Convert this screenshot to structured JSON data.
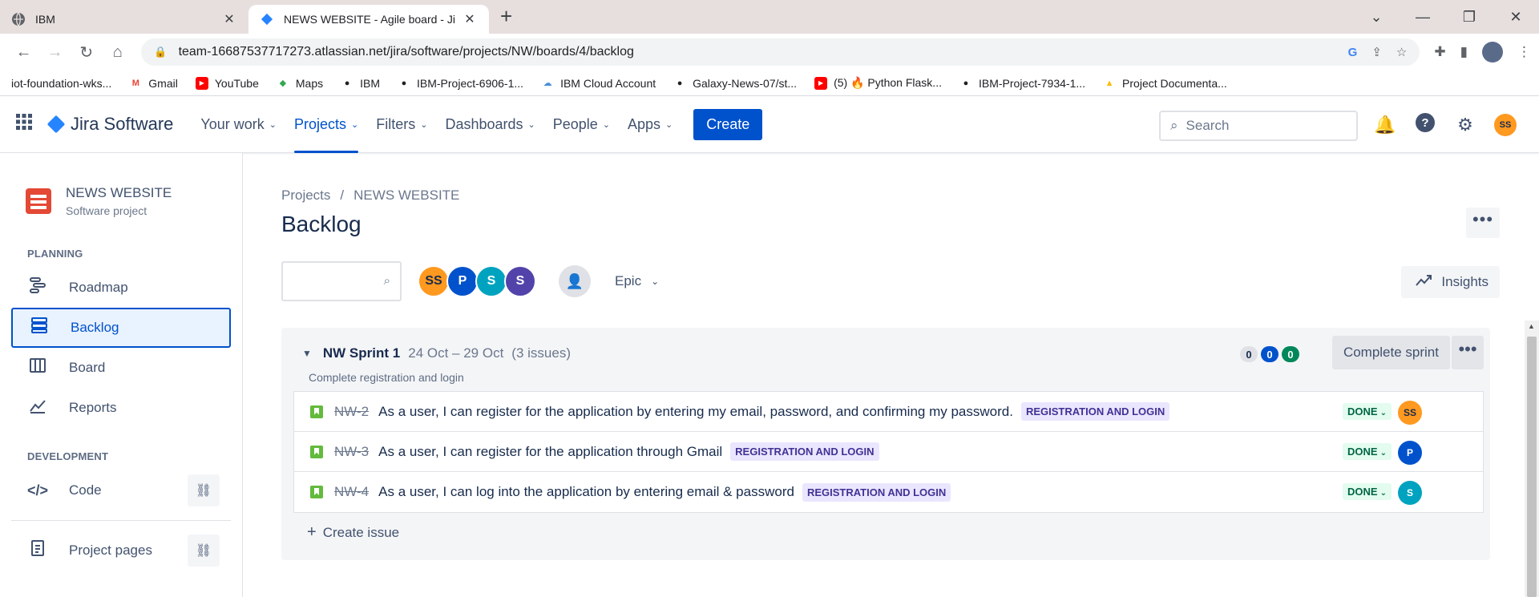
{
  "browser": {
    "tabs": [
      {
        "title": "IBM",
        "active": false
      },
      {
        "title": "NEWS WEBSITE - Agile board - Ji",
        "active": true
      }
    ],
    "url": "team-16687537717273.atlassian.net/jira/software/projects/NW/boards/4/backlog",
    "bookmarks": [
      "iot-foundation-wks...",
      "Gmail",
      "YouTube",
      "Maps",
      "IBM",
      "IBM-Project-6906-1...",
      "IBM Cloud Account",
      "Galaxy-News-07/st...",
      "(5) 🔥 Python Flask...",
      "IBM-Project-7934-1...",
      "Project Documenta..."
    ]
  },
  "jira": {
    "logo": "Jira Software",
    "nav": [
      {
        "label": "Your work",
        "active": false
      },
      {
        "label": "Projects",
        "active": true
      },
      {
        "label": "Filters",
        "active": false
      },
      {
        "label": "Dashboards",
        "active": false
      },
      {
        "label": "People",
        "active": false
      },
      {
        "label": "Apps",
        "active": false
      }
    ],
    "create_label": "Create",
    "search_placeholder": "Search",
    "user_initials": "SS"
  },
  "sidebar": {
    "project_name": "NEWS WEBSITE",
    "project_type": "Software project",
    "planning_heading": "PLANNING",
    "planning_items": [
      {
        "label": "Roadmap",
        "icon": "roadmap-icon"
      },
      {
        "label": "Backlog",
        "icon": "backlog-icon",
        "selected": true
      },
      {
        "label": "Board",
        "icon": "board-icon"
      },
      {
        "label": "Reports",
        "icon": "reports-icon"
      }
    ],
    "development_heading": "DEVELOPMENT",
    "code_label": "Code",
    "project_pages_label": "Project pages"
  },
  "main": {
    "breadcrumb": [
      "Projects",
      "NEWS WEBSITE"
    ],
    "breadcrumb_sep": "/",
    "title": "Backlog",
    "avatars": [
      {
        "initials": "SS",
        "color": "#ff991f"
      },
      {
        "initials": "P",
        "color": "#0052cc"
      },
      {
        "initials": "S",
        "color": "#00a3bf"
      },
      {
        "initials": "S",
        "color": "#5243aa"
      }
    ],
    "epic_label": "Epic",
    "insights_label": "Insights",
    "sprint": {
      "name": "NW Sprint 1",
      "dates": "24 Oct – 29 Oct",
      "count": "(3 issues)",
      "goal": "Complete registration and login",
      "counts": {
        "todo": "0",
        "in_progress": "0",
        "done": "0"
      },
      "complete_label": "Complete sprint",
      "issues": [
        {
          "key": "NW-2",
          "summary": "As a user, I can register for the application by entering my email, password, and confirming my password.",
          "label": "REGISTRATION AND LOGIN",
          "status": "DONE",
          "assignee": "SS",
          "assignee_color": "#ff991f"
        },
        {
          "key": "NW-3",
          "summary": "As a user, I can register for the application through Gmail",
          "label": "REGISTRATION AND LOGIN",
          "status": "DONE",
          "assignee": "P",
          "assignee_color": "#0052cc"
        },
        {
          "key": "NW-4",
          "summary": "As a user, I can log into the application by entering email & password",
          "label": "REGISTRATION AND LOGIN",
          "status": "DONE",
          "assignee": "S",
          "assignee_color": "#00a3bf"
        }
      ],
      "create_issue_label": "Create issue"
    }
  }
}
